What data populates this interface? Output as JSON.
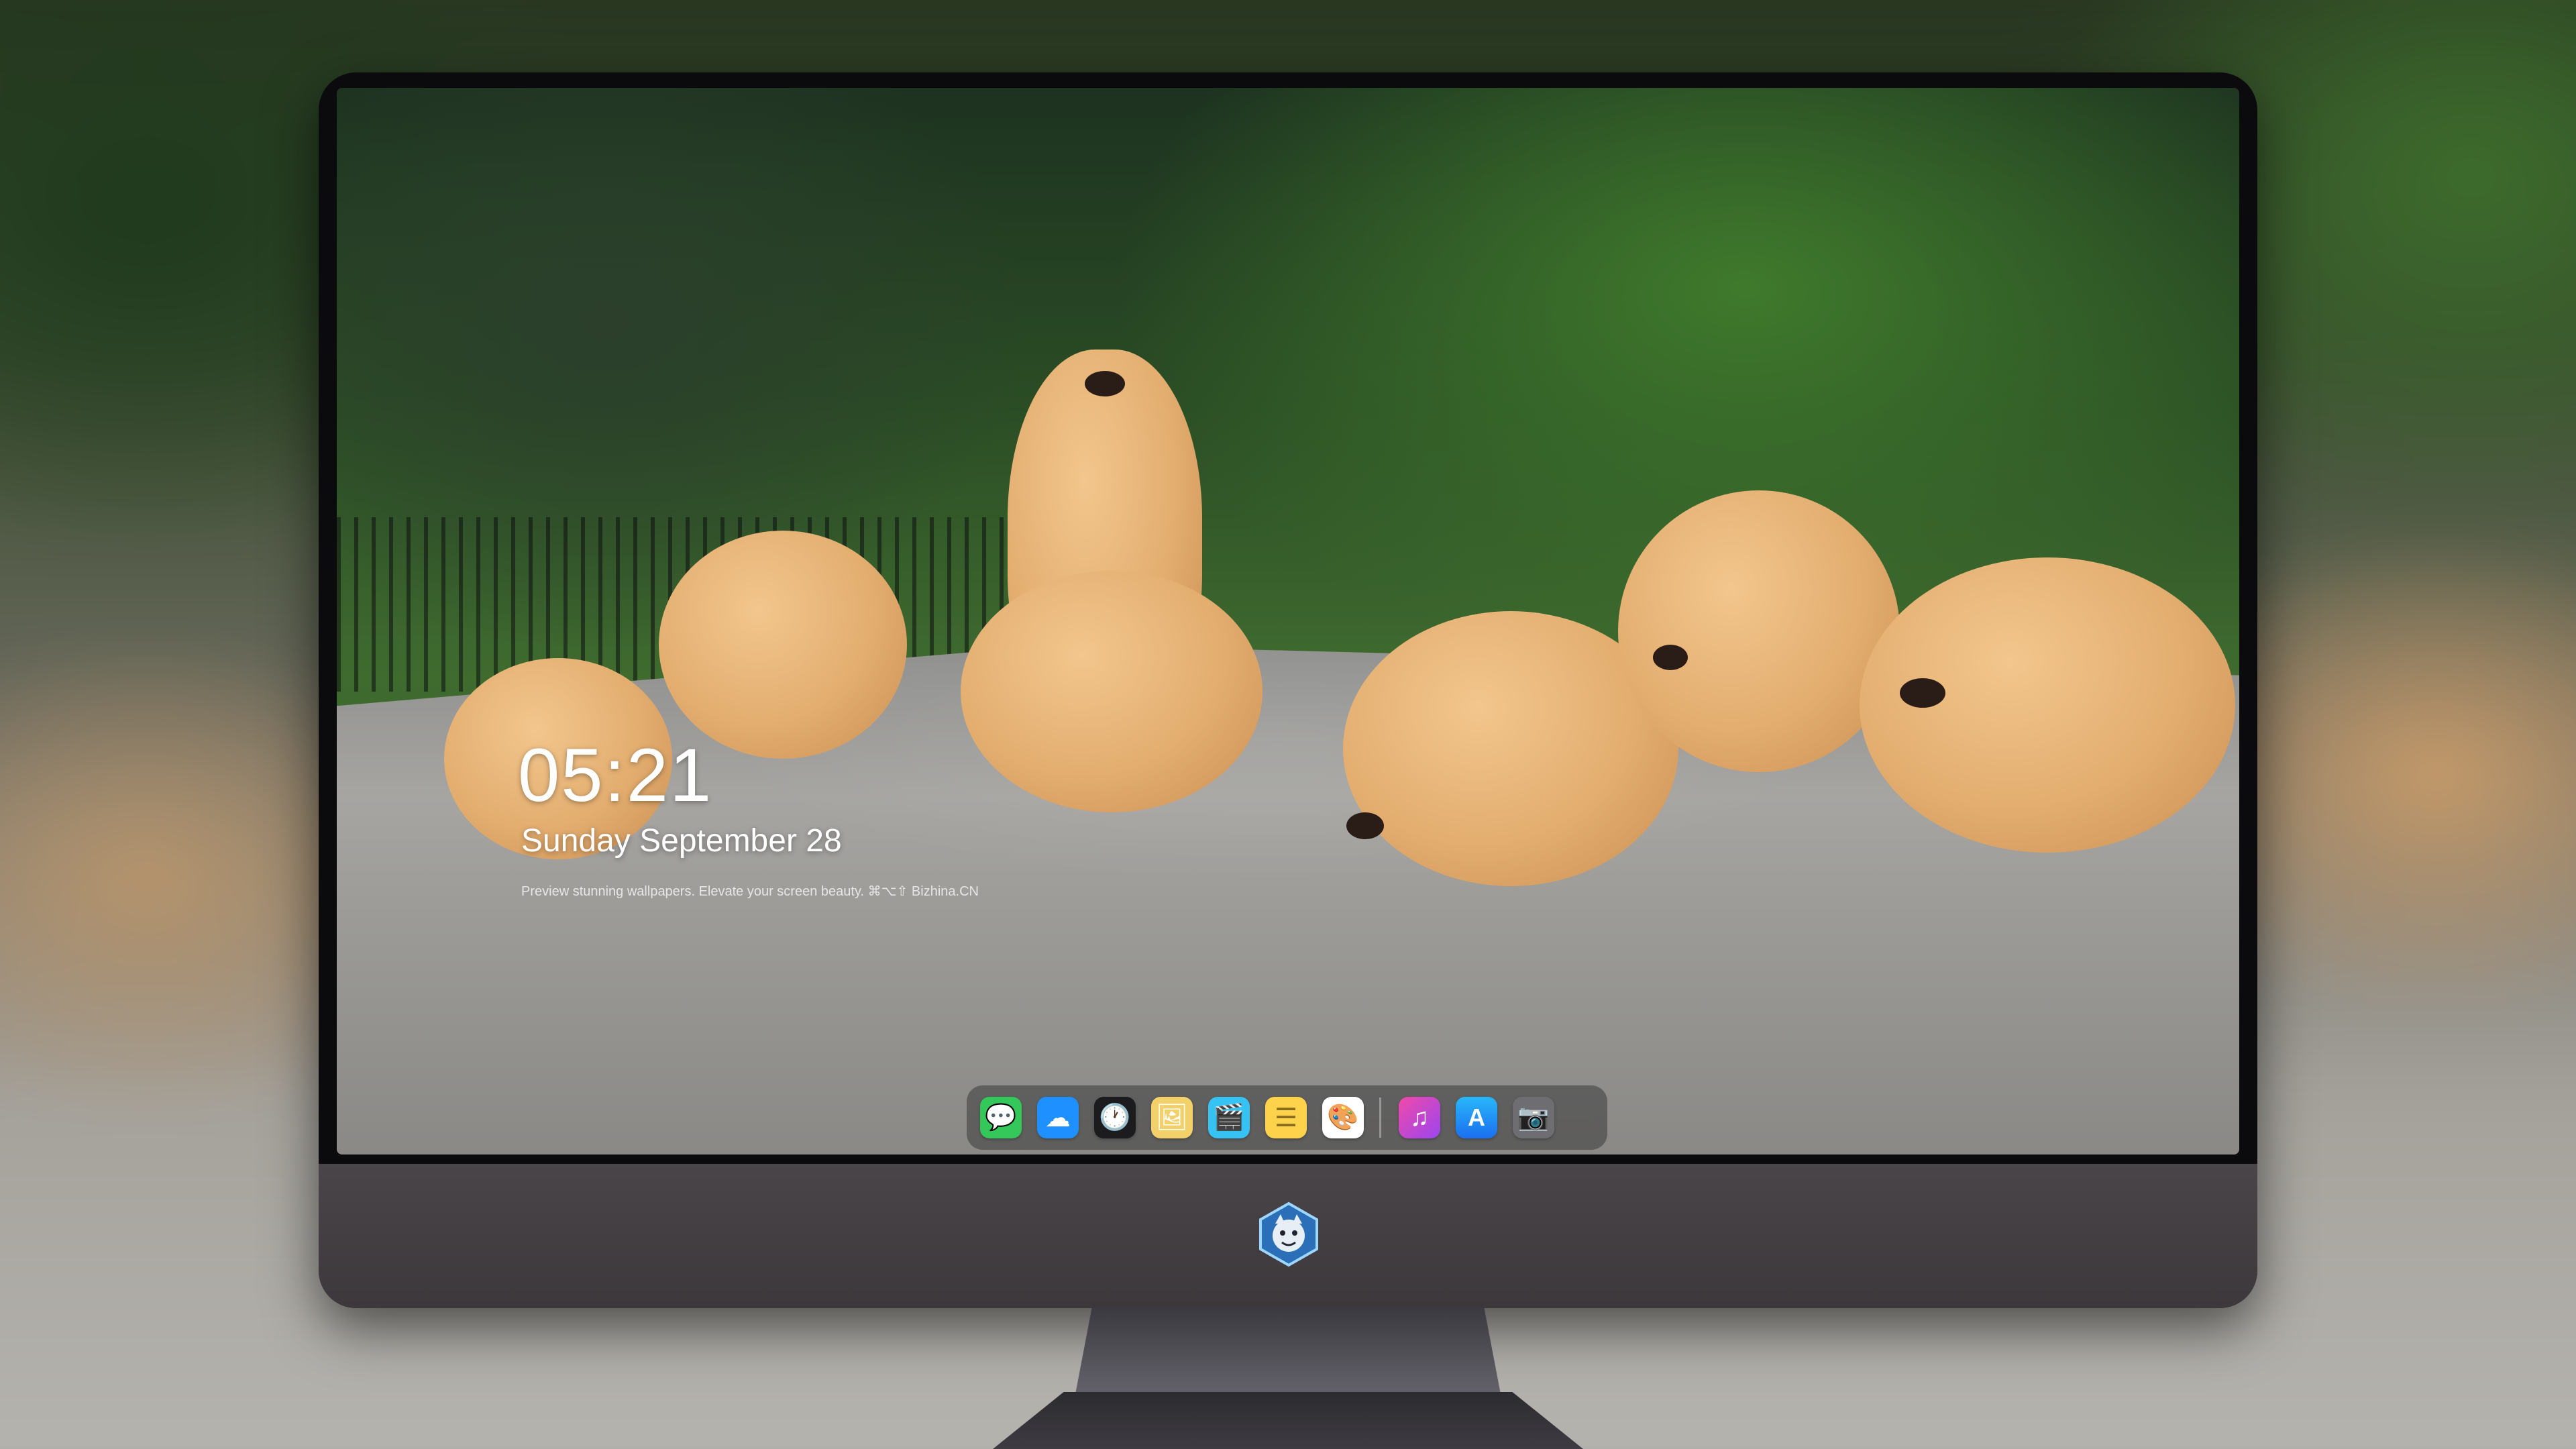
{
  "lockscreen": {
    "time": "05:21",
    "date": "Sunday September  28",
    "caption": "Preview stunning wallpapers. Elevate your screen beauty. ⌘⌥⇧     Bizhina.CN"
  },
  "dock": {
    "apps": [
      {
        "name": "Messages",
        "glyph": "💬",
        "color": "#34c759"
      },
      {
        "name": "Weather",
        "glyph": "☁",
        "color": "#1e90ff"
      },
      {
        "name": "Clock",
        "glyph": "🕐",
        "color": "#1c1c1e"
      },
      {
        "name": "Preview",
        "glyph": "🖼",
        "color": "#f2d16b"
      },
      {
        "name": "Final Cut",
        "glyph": "🎬",
        "color": "#36c2f2"
      },
      {
        "name": "Notes",
        "glyph": "☰",
        "color": "#ffd24c"
      },
      {
        "name": "Photo Booth",
        "glyph": "🎨",
        "color": "#ffffff"
      },
      {
        "name": "iTunes",
        "glyph": "♫",
        "color": "#c04af3"
      },
      {
        "name": "App Store",
        "glyph": "A",
        "color": "#1b8ff7"
      },
      {
        "name": "Camera",
        "glyph": "📷",
        "color": "#6e6e72"
      }
    ]
  },
  "colors": {
    "monitor_chin": "#3d383b",
    "dock_bg": "rgba(40,40,42,0.45)"
  }
}
